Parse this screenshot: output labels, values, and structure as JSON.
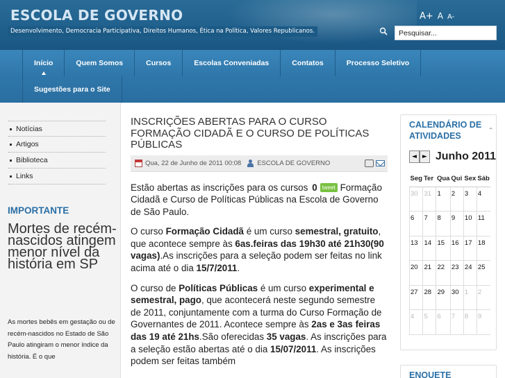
{
  "header": {
    "site_title": "ESCOLA DE GOVERNO",
    "tagline": "Desenvolvimento, Democracia Participativa, Direitos Humanos, Ética na Política, Valores Republicanos.",
    "font_increase": "A+",
    "font_default": "A",
    "font_decrease": "A-",
    "search_placeholder": "Pesquisar..."
  },
  "nav": {
    "items": [
      {
        "label": "Início",
        "active": true
      },
      {
        "label": "Quem Somos"
      },
      {
        "label": "Cursos"
      },
      {
        "label": "Escolas Conveniadas"
      },
      {
        "label": "Contatos"
      },
      {
        "label": "Processo Seletivo"
      },
      {
        "label": "Sugestões para o Site"
      }
    ]
  },
  "sidebar": {
    "links": [
      "Notícias",
      "Artigos",
      "Biblioteca",
      "Links"
    ],
    "important_title": "IMPORTANTE",
    "important_headline": "Mortes de recém-nascidos atingem menor nível da história em SP",
    "important_body": "As mortes bebês em gestação ou de recém-nascidos no Estado de São Paulo atingiram o menor índice da história. É o que"
  },
  "article": {
    "title": "INSCRIÇÕES ABERTAS PARA O CURSO FORMAÇÃO CIDADÃ E O CURSO DE POLÍTICAS PÚBLICAS",
    "date": "Qua, 22 de Junho de 2011 00:08",
    "author": "ESCOLA DE GOVERNO",
    "tweet_count": "0",
    "tweet_label": "tweet",
    "p1_a": "Estão abertas as inscrições para os cursos",
    "p1_b": "Formação Cidadã e Curso de Políticas Públicas na Escola de Governo de São Paulo.",
    "p2_a": "O curso ",
    "p2_b": "Formação Cidadã",
    "p2_c": " é um curso ",
    "p2_d": "semestral, gratuito",
    "p2_e": ", que acontece sempre às ",
    "p2_f": "6as.feiras das 19h30 até 21h30(90 vagas)",
    "p2_g": ".As inscrições para a seleção podem ser feitas no link acima até o dia ",
    "p2_h": "15/7/2011",
    "p2_i": ".",
    "p3_a": "O curso de ",
    "p3_b": "Políticas Públicas",
    "p3_c": " é um curso ",
    "p3_d": "experimental e semestral, pago",
    "p3_e": ", que acontecerá neste segundo semestre de 2011, conjuntamente com a turma do Curso Formação de Governantes de 2011. Acontece sempre às ",
    "p3_f": "2as  e 3as feiras das 19 até 21hs",
    "p3_g": ".São oferecidas ",
    "p3_h": "35 vagas",
    "p3_i": ". As inscrições para a seleção estão abertas até o dia ",
    "p3_j": "15/07/2011",
    "p3_k": ". As inscrições podem ser feitas também"
  },
  "calendar": {
    "title": "CALENDÁRIO DE ATIVIDADES",
    "prev": "◄",
    "next": "►",
    "month": "Junho 2011",
    "weekdays": [
      "Seg",
      "Ter",
      "Qua",
      "Qui",
      "Sex",
      "Sáb"
    ],
    "weeks": [
      [
        {
          "d": "30",
          "o": true
        },
        {
          "d": "31",
          "o": true
        },
        {
          "d": "1"
        },
        {
          "d": "2"
        },
        {
          "d": "3"
        },
        {
          "d": "4"
        }
      ],
      [
        {
          "d": "6"
        },
        {
          "d": "7"
        },
        {
          "d": "8"
        },
        {
          "d": "9"
        },
        {
          "d": "10"
        },
        {
          "d": "11"
        }
      ],
      [
        {
          "d": "13"
        },
        {
          "d": "14"
        },
        {
          "d": "15"
        },
        {
          "d": "16"
        },
        {
          "d": "17"
        },
        {
          "d": "18"
        }
      ],
      [
        {
          "d": "20"
        },
        {
          "d": "21"
        },
        {
          "d": "22"
        },
        {
          "d": "23"
        },
        {
          "d": "24"
        },
        {
          "d": "25"
        }
      ],
      [
        {
          "d": "27"
        },
        {
          "d": "28"
        },
        {
          "d": "29"
        },
        {
          "d": "30"
        },
        {
          "d": "1",
          "o": true
        },
        {
          "d": "2",
          "o": true
        }
      ],
      [
        {
          "d": "4",
          "o": true
        },
        {
          "d": "5",
          "o": true
        },
        {
          "d": "6",
          "o": true
        },
        {
          "d": "7",
          "o": true
        },
        {
          "d": "8",
          "o": true
        },
        {
          "d": "9",
          "o": true
        }
      ]
    ]
  },
  "enquete": {
    "title": "ENQUETE"
  },
  "colors": {
    "header_bg": "#1f5f8c",
    "nav_bg": "#2f77aa",
    "accent": "#2a6fa5",
    "tweet": "#7ac142"
  }
}
